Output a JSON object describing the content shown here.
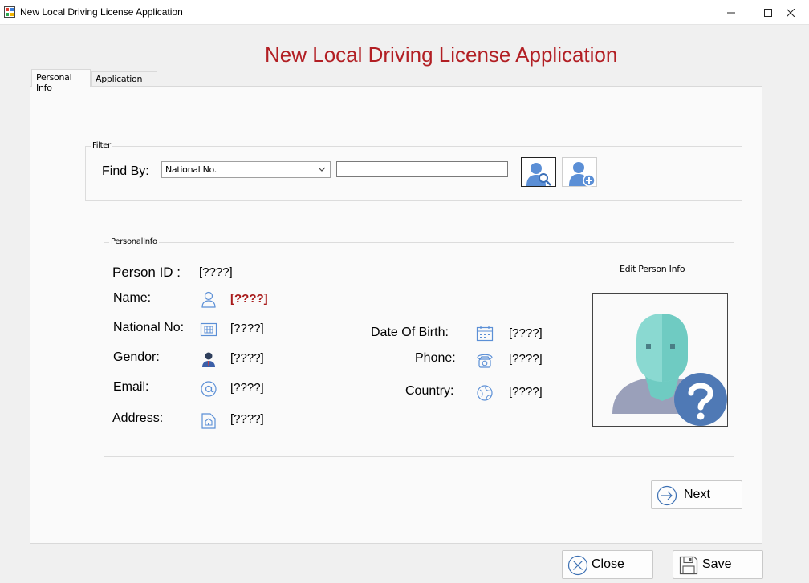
{
  "window": {
    "title": "New Local Driving License Application",
    "minimize": "—",
    "maximize": "☐",
    "close": "✕"
  },
  "heading": "New Local Driving License Application",
  "tabs": [
    {
      "label": "Personal Info"
    },
    {
      "label": "Application Info"
    }
  ],
  "filter": {
    "group_title": "Filter",
    "find_by_label": "Find By:",
    "find_by_selected": "National No.",
    "search_value": ""
  },
  "person": {
    "group_title": "PersonalInfo",
    "person_id_label": "Person ID :",
    "person_id_value": "[????]",
    "name_label": "Name:",
    "name_value": "[????]",
    "national_no_label": "National No:",
    "national_no_value": "[????]",
    "gendor_label": "Gendor:",
    "gendor_value": "[????]",
    "email_label": "Email:",
    "email_value": "[????]",
    "address_label": "Address:",
    "address_value": "[????]",
    "dob_label": "Date Of Birth:",
    "dob_value": "[????]",
    "phone_label": "Phone:",
    "phone_value": "[????]",
    "country_label": "Country:",
    "country_value": "[????]",
    "edit_link": "Edit Person Info"
  },
  "buttons": {
    "next": "Next",
    "close": "Close",
    "save": "Save"
  },
  "colors": {
    "heading": "#b21f24",
    "icon_blue": "#5b8fd6",
    "photo_teal": "#6fcbc2",
    "photo_badge": "#4f79b5"
  }
}
